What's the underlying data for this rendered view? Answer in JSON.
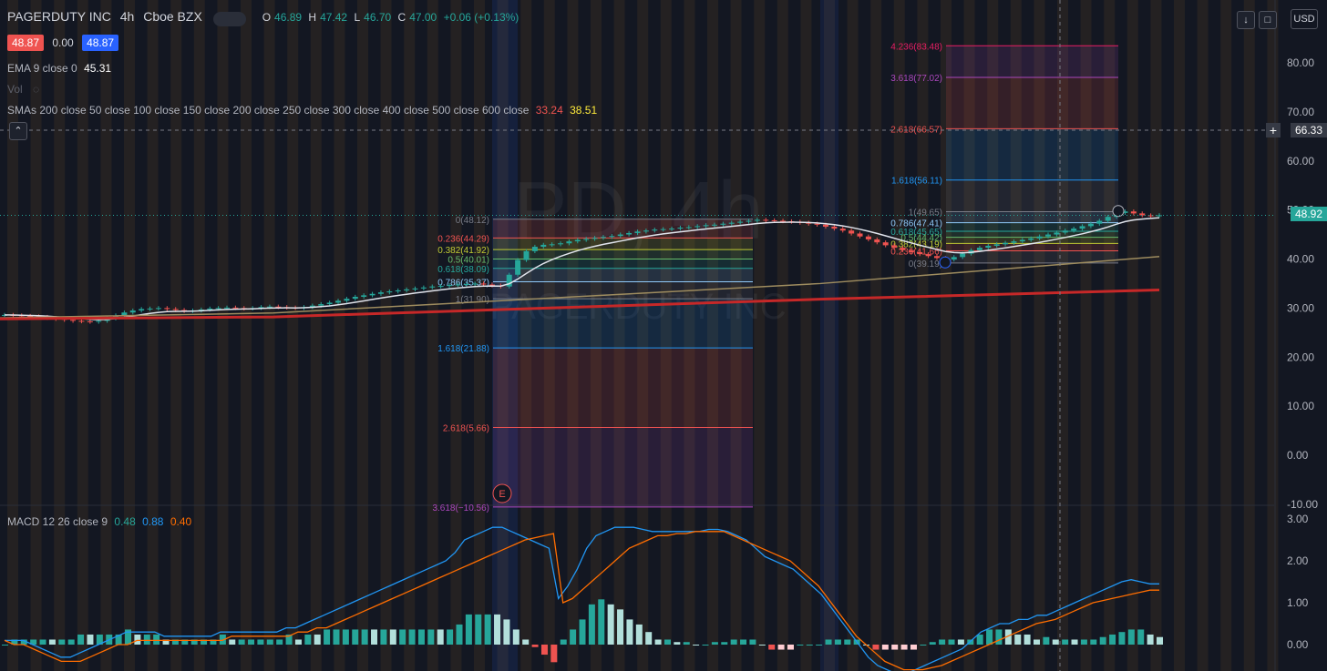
{
  "header": {
    "symbol": "PAGERDUTY INC",
    "interval": "4h",
    "exchange": "Cboe BZX",
    "ohlc": {
      "o_label": "O",
      "o": "46.89",
      "h_label": "H",
      "h": "47.42",
      "l_label": "L",
      "l": "46.70",
      "c_label": "C",
      "c": "47.00",
      "change": "+0.06 (+0.13%)"
    },
    "bid": "48.87",
    "spread": "0.00",
    "ask": "48.87"
  },
  "indicators": {
    "ema_label": "EMA 9 close 0",
    "ema_value": "45.31",
    "vol_label": "Vol",
    "sma_label": "SMAs 200 close 50 close 100 close 150 close 200 close 250 close 300 close 400 close 500 close 600 close",
    "sma_value1": "33.24",
    "sma_value2": "38.51",
    "macd_label": "MACD 12 26 close 9",
    "macd_v1": "0.48",
    "macd_v2": "0.88",
    "macd_v3": "0.40"
  },
  "watermark": {
    "line1": "PD, 4h",
    "line2": "PAGERDUTY INC"
  },
  "currency": "USD",
  "crosshair_price": "66.33",
  "last_price": "48.92",
  "colors": {
    "bg": "#131722",
    "up": "#26a69a",
    "down": "#ef5350",
    "ema": "#e0e3eb",
    "sma_red": "#c62828",
    "sma_tan": "#9e8c5f",
    "macd": "#2196f3",
    "signal": "#ff6d00"
  },
  "chart_data": {
    "type": "candlestick",
    "y_axis": {
      "min": -10,
      "max": 88,
      "ticks": [
        "80.00",
        "70.00",
        "60.00",
        "50.00",
        "40.00",
        "30.00",
        "20.00",
        "10.00",
        "0.00",
        "-10.00"
      ]
    },
    "macd_axis": {
      "ticks": [
        "3.00",
        "2.00",
        "1.00",
        "0.00"
      ]
    },
    "close": [
      28.6,
      28.5,
      28.4,
      28.3,
      28.2,
      28.0,
      27.8,
      27.6,
      27.4,
      27.3,
      27.2,
      27.4,
      27.9,
      28.5,
      29.1,
      29.5,
      29.8,
      29.9,
      30.0,
      29.8,
      29.6,
      29.4,
      29.5,
      29.7,
      29.9,
      30.0,
      30.1,
      30.0,
      29.9,
      30.0,
      30.2,
      30.3,
      30.2,
      30.1,
      30.0,
      30.2,
      30.5,
      30.8,
      31.1,
      31.5,
      31.9,
      32.3,
      32.6,
      32.9,
      33.2,
      33.4,
      33.6,
      33.8,
      34.0,
      34.2,
      34.4,
      34.5,
      34.7,
      34.8,
      34.9,
      35.0,
      34.8,
      34.6,
      34.4,
      36.8,
      39.8,
      41.6,
      42.5,
      42.9,
      43.0,
      43.2,
      43.6,
      43.9,
      44.1,
      44.3,
      44.5,
      44.7,
      45.0,
      45.3,
      45.6,
      45.8,
      46.0,
      46.1,
      46.2,
      46.4,
      46.5,
      46.7,
      46.9,
      47.0,
      47.2,
      47.4,
      47.6,
      47.8,
      48.0,
      47.9,
      47.8,
      47.7,
      47.6,
      47.4,
      47.2,
      47.0,
      46.6,
      46.2,
      45.8,
      45.2,
      44.6,
      44.0,
      43.4,
      42.8,
      42.3,
      41.8,
      41.4,
      41.0,
      40.6,
      40.2,
      39.9,
      40.4,
      41.1,
      41.8,
      42.3,
      42.7,
      43.0,
      43.3,
      43.6,
      43.9,
      44.2,
      44.6,
      45.0,
      45.4,
      45.8,
      46.2,
      46.7,
      47.2,
      47.8,
      48.6,
      49.4,
      49.7,
      49.3,
      48.9,
      48.8,
      48.92
    ],
    "macd_line": [
      0.1,
      0.1,
      0.1,
      0.0,
      -0.1,
      -0.2,
      -0.3,
      -0.3,
      -0.2,
      -0.1,
      0.0,
      0.1,
      0.2,
      0.3,
      0.3,
      0.3,
      0.3,
      0.2,
      0.2,
      0.2,
      0.2,
      0.2,
      0.2,
      0.3,
      0.3,
      0.3,
      0.3,
      0.3,
      0.3,
      0.3,
      0.4,
      0.4,
      0.5,
      0.6,
      0.7,
      0.8,
      0.9,
      1.0,
      1.1,
      1.2,
      1.3,
      1.4,
      1.5,
      1.6,
      1.7,
      1.8,
      1.9,
      2.0,
      2.2,
      2.5,
      2.6,
      2.7,
      2.8,
      2.8,
      2.7,
      2.6,
      2.5,
      2.4,
      2.3,
      1.1,
      1.4,
      1.8,
      2.3,
      2.6,
      2.7,
      2.8,
      2.8,
      2.8,
      2.75,
      2.7,
      2.7,
      2.7,
      2.7,
      2.7,
      2.7,
      2.75,
      2.75,
      2.7,
      2.6,
      2.5,
      2.3,
      2.1,
      2.0,
      1.9,
      1.8,
      1.6,
      1.4,
      1.2,
      0.9,
      0.6,
      0.3,
      0.0,
      -0.3,
      -0.5,
      -0.6,
      -0.7,
      -0.7,
      -0.6,
      -0.5,
      -0.4,
      -0.3,
      -0.2,
      -0.1,
      0.1,
      0.3,
      0.4,
      0.5,
      0.5,
      0.6,
      0.6,
      0.7,
      0.7,
      0.8,
      0.9,
      1.0,
      1.1,
      1.2,
      1.3,
      1.4,
      1.5,
      1.55,
      1.5,
      1.45,
      1.45
    ],
    "signal_line": [
      0.1,
      0.0,
      0.0,
      -0.1,
      -0.2,
      -0.3,
      -0.4,
      -0.4,
      -0.4,
      -0.3,
      -0.2,
      -0.1,
      0.0,
      0.0,
      0.1,
      0.1,
      0.1,
      0.1,
      0.1,
      0.1,
      0.1,
      0.1,
      0.1,
      0.1,
      0.2,
      0.2,
      0.2,
      0.2,
      0.2,
      0.2,
      0.2,
      0.3,
      0.3,
      0.4,
      0.4,
      0.5,
      0.6,
      0.7,
      0.8,
      0.9,
      1.0,
      1.1,
      1.2,
      1.3,
      1.4,
      1.5,
      1.6,
      1.7,
      1.8,
      1.9,
      2.0,
      2.1,
      2.2,
      2.3,
      2.4,
      2.5,
      2.55,
      2.6,
      2.65,
      1.0,
      1.1,
      1.3,
      1.5,
      1.7,
      1.9,
      2.1,
      2.3,
      2.4,
      2.5,
      2.6,
      2.6,
      2.65,
      2.65,
      2.7,
      2.7,
      2.7,
      2.7,
      2.6,
      2.5,
      2.4,
      2.3,
      2.2,
      2.1,
      2.0,
      1.8,
      1.6,
      1.4,
      1.1,
      0.8,
      0.5,
      0.2,
      0.0,
      -0.2,
      -0.4,
      -0.5,
      -0.6,
      -0.6,
      -0.6,
      -0.55,
      -0.5,
      -0.4,
      -0.3,
      -0.2,
      -0.1,
      0.0,
      0.1,
      0.2,
      0.3,
      0.4,
      0.5,
      0.55,
      0.6,
      0.7,
      0.8,
      0.9,
      1.0,
      1.05,
      1.1,
      1.15,
      1.2,
      1.25,
      1.3,
      1.3
    ],
    "fib_retracement_1": {
      "levels": [
        {
          "label": "0(48.12)",
          "price": 48.12,
          "color": "#787b86"
        },
        {
          "label": "0.236(44.29)",
          "price": 44.29,
          "color": "#ef5350"
        },
        {
          "label": "0.382(41.92)",
          "price": 41.92,
          "color": "#c0ca33"
        },
        {
          "label": "0.5(40.01)",
          "price": 40.01,
          "color": "#66bb6a"
        },
        {
          "label": "0.618(38.09)",
          "price": 38.09,
          "color": "#26a69a"
        },
        {
          "label": "0.786(35.37)",
          "price": 35.37,
          "color": "#90caf9"
        },
        {
          "label": "1(31.90)",
          "price": 31.9,
          "color": "#787b86"
        },
        {
          "label": "1.618(21.88)",
          "price": 21.88,
          "color": "#2196f3"
        },
        {
          "label": "2.618(5.66)",
          "price": 5.66,
          "color": "#ef5350"
        },
        {
          "label": "3.618(−10.56)",
          "price": -10.56,
          "color": "#ab47bc"
        }
      ]
    },
    "fib_retracement_2": {
      "levels": [
        {
          "label": "4.236(83.48)",
          "price": 83.48,
          "color": "#e91e63"
        },
        {
          "label": "3.618(77.02)",
          "price": 77.02,
          "color": "#ab47bc"
        },
        {
          "label": "2.618(66.57)",
          "price": 66.57,
          "color": "#ef5350"
        },
        {
          "label": "1.618(56.11)",
          "price": 56.11,
          "color": "#2196f3"
        },
        {
          "label": "1(49.65)",
          "price": 49.65,
          "color": "#787b86"
        },
        {
          "label": "0.786(47.41)",
          "price": 47.41,
          "color": "#90caf9"
        },
        {
          "label": "0.618(45.65)",
          "price": 45.65,
          "color": "#26a69a"
        },
        {
          "label": "0.5(44.42)",
          "price": 44.42,
          "color": "#66bb6a"
        },
        {
          "label": "0.382(43.19)",
          "price": 43.19,
          "color": "#c0ca33"
        },
        {
          "label": "0.236(41.66)",
          "price": 41.66,
          "color": "#ef5350"
        },
        {
          "label": "0(39.19)",
          "price": 39.19,
          "color": "#787b86"
        }
      ]
    },
    "earnings_marker": "E"
  }
}
